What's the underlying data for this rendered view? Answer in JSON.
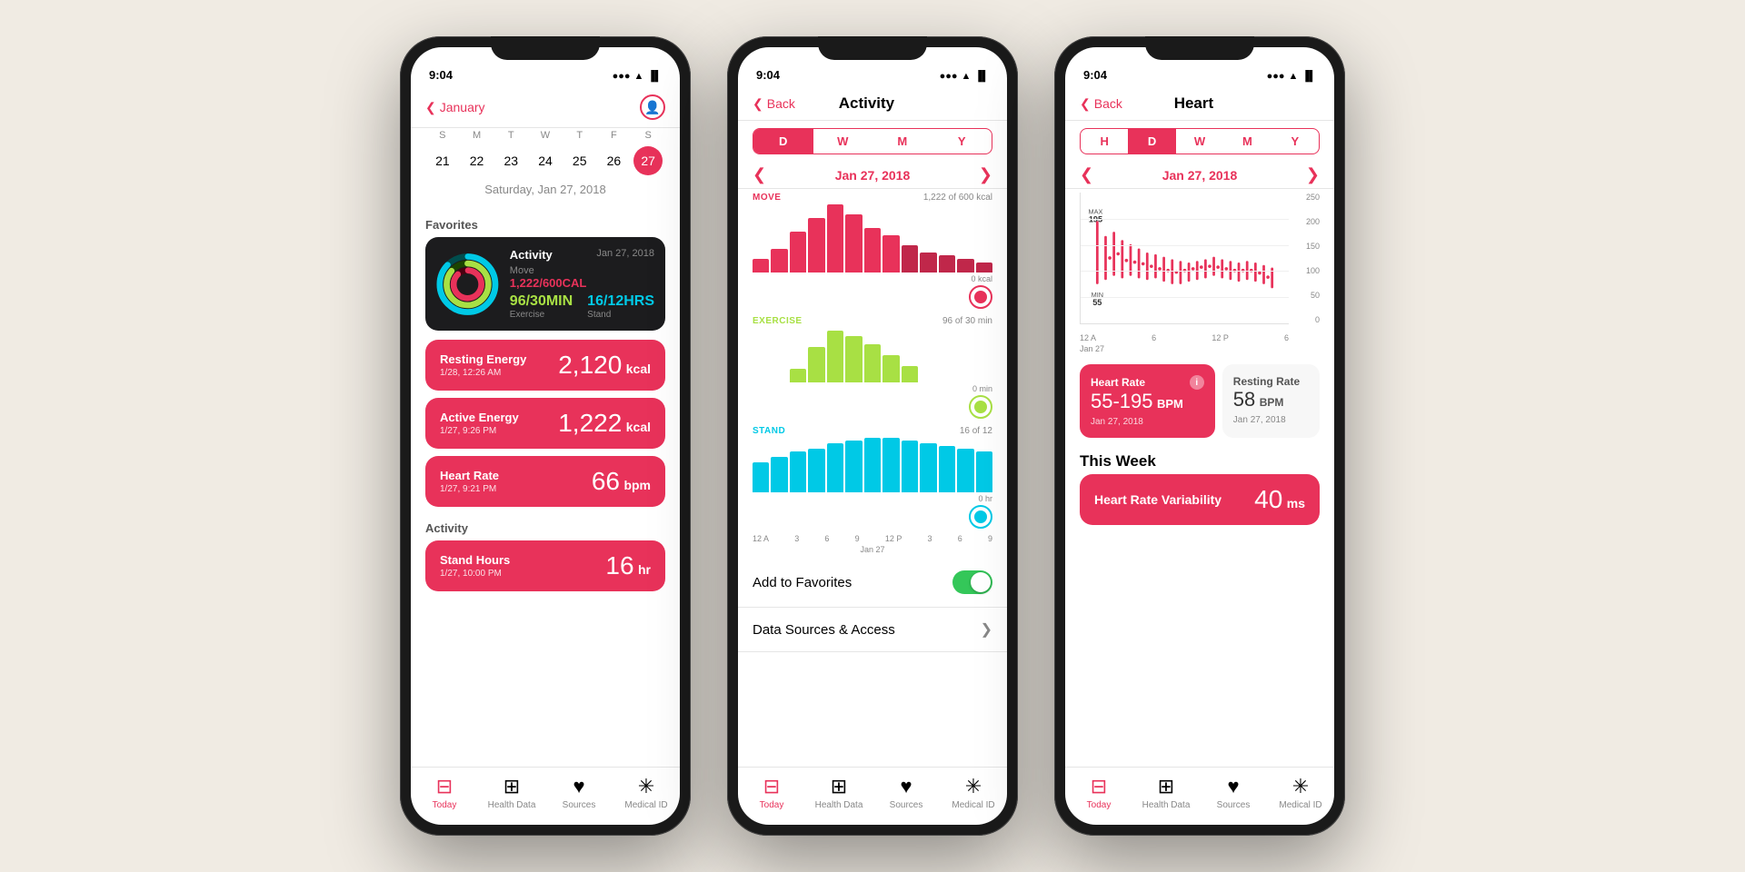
{
  "phones": [
    {
      "id": "phone1",
      "status_time": "9:04",
      "screen": "today",
      "nav": {
        "back_label": "January",
        "title": "",
        "has_profile": true
      },
      "calendar": {
        "month": "January",
        "day_headers": [
          "S",
          "M",
          "T",
          "W",
          "T",
          "F",
          "S"
        ],
        "days": [
          "21",
          "22",
          "23",
          "24",
          "25",
          "26",
          "27"
        ],
        "selected_date": "Saturday, Jan 27, 2018"
      },
      "favorites_header": "Favorites",
      "activity_card": {
        "date": "Jan 27, 2018",
        "move_label": "Move",
        "move_value": "1,222/600CAL",
        "exercise_label": "Exercise",
        "exercise_value": "96/30MIN",
        "stand_label": "Stand",
        "stand_value": "16/12HRS"
      },
      "metrics": [
        {
          "name": "Resting Energy",
          "value": "2,120",
          "unit": "kcal",
          "sub": "1/28, 12:26 AM"
        },
        {
          "name": "Active Energy",
          "value": "1,222",
          "unit": "kcal",
          "sub": "1/27, 9:26 PM"
        },
        {
          "name": "Heart Rate",
          "value": "66",
          "unit": "bpm",
          "sub": "1/27, 9:21 PM"
        }
      ],
      "activity_header": "Activity",
      "stand_hours": {
        "name": "Stand Hours",
        "value": "16",
        "unit": "hr",
        "sub": "1/27, 10:00 PM"
      },
      "tabs": [
        {
          "icon": "📋",
          "label": "Today",
          "active": true
        },
        {
          "icon": "⊞",
          "label": "Health Data",
          "active": false
        },
        {
          "icon": "♥",
          "label": "Sources",
          "active": false
        },
        {
          "icon": "✳",
          "label": "Medical ID",
          "active": false
        }
      ]
    },
    {
      "id": "phone2",
      "status_time": "9:04",
      "screen": "activity",
      "nav": {
        "back_label": "Back",
        "title": "Activity"
      },
      "period_tabs": [
        "D",
        "W",
        "M",
        "Y"
      ],
      "active_period": "D",
      "date_nav": "Jan 27, 2018",
      "charts": {
        "move": {
          "label": "MOVE",
          "goal": "1,222 of 600 kcal",
          "bars": [
            20,
            35,
            60,
            80,
            100,
            85,
            65,
            55,
            40,
            30,
            25,
            20,
            15
          ]
        },
        "exercise": {
          "label": "EXERCISE",
          "goal": "96 of 30 min",
          "bars": [
            0,
            0,
            20,
            50,
            70,
            60,
            45,
            35,
            25,
            0,
            0,
            0,
            0
          ]
        },
        "stand": {
          "label": "STAND",
          "goal": "16 of 12",
          "bars": [
            40,
            50,
            60,
            65,
            70,
            72,
            68,
            65,
            60,
            58,
            55,
            52,
            50
          ]
        }
      },
      "add_to_favorites": "Add to Favorites",
      "favorites_toggle": true,
      "data_sources": "Data Sources & Access",
      "tabs": [
        {
          "icon": "📋",
          "label": "Today",
          "active": true
        },
        {
          "icon": "⊞",
          "label": "Health Data",
          "active": false
        },
        {
          "icon": "♥",
          "label": "Sources",
          "active": false
        },
        {
          "icon": "✳",
          "label": "Medical ID",
          "active": false
        }
      ]
    },
    {
      "id": "phone3",
      "status_time": "9:04",
      "screen": "heart",
      "nav": {
        "back_label": "Back",
        "title": "Heart"
      },
      "period_tabs": [
        "H",
        "D",
        "W",
        "M",
        "Y"
      ],
      "active_period": "D",
      "date_nav": "Jan 27, 2018",
      "chart": {
        "max_label": "MAX",
        "max_value": "195",
        "min_label": "MIN",
        "min_value": "55",
        "y_labels": [
          "250",
          "200",
          "150",
          "100",
          "50",
          "0"
        ]
      },
      "heart_rate_card": {
        "title": "Heart Rate",
        "value": "55-195",
        "unit": "BPM",
        "date": "Jan 27, 2018"
      },
      "resting_card": {
        "title": "Resting Rate",
        "value": "58",
        "unit": "BPM",
        "date": "Jan 27, 2018"
      },
      "this_week": "This Week",
      "hrv_card": {
        "name": "Heart Rate Variability",
        "value": "40",
        "unit": "ms"
      },
      "tabs": [
        {
          "icon": "📋",
          "label": "Today",
          "active": true
        },
        {
          "icon": "⊞",
          "label": "Health Data",
          "active": false
        },
        {
          "icon": "♥",
          "label": "Sources",
          "active": false
        },
        {
          "icon": "✳",
          "label": "Medical ID",
          "active": false
        }
      ]
    }
  ]
}
